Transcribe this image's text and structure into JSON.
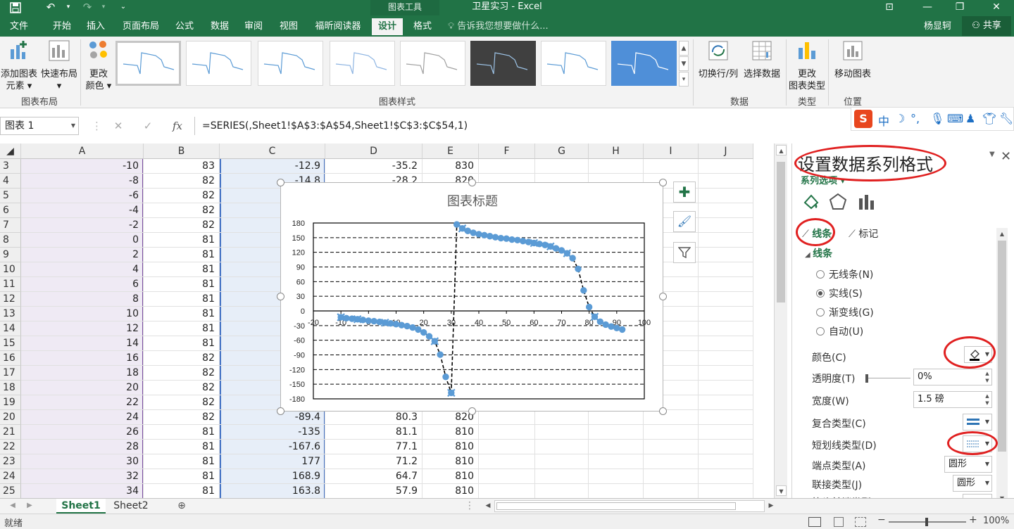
{
  "titlebar": {
    "context_tab": "图表工具",
    "window_title": "卫星实习 - Excel"
  },
  "tabs": {
    "file": "文件",
    "home": "开始",
    "insert": "插入",
    "page_layout": "页面布局",
    "formulas": "公式",
    "data": "数据",
    "review": "审阅",
    "view": "视图",
    "foxit": "福昕阅读器",
    "design": "设计",
    "format": "格式",
    "tell_me": "告诉我您想要做什么...",
    "user": "杨显轲",
    "share": "共享"
  },
  "ribbon": {
    "add_element_line1": "添加图表",
    "add_element_line2": "元素",
    "quick_layout": "快速布局",
    "change_colors_line1": "更改",
    "change_colors_line2": "颜色",
    "group_layout": "图表布局",
    "group_styles": "图表样式",
    "switch_row_col": "切换行/列",
    "select_data": "选择数据",
    "group_data": "数据",
    "change_type_line1": "更改",
    "change_type_line2": "图表类型",
    "group_type": "类型",
    "move_chart": "移动图表",
    "group_location": "位置"
  },
  "formula_bar": {
    "name_box": "图表 1",
    "fx": "fx",
    "formula": "=SERIES(,Sheet1!$A$3:$A$54,Sheet1!$C$3:$C$54,1)"
  },
  "columns": [
    "A",
    "B",
    "C",
    "D",
    "E",
    "F",
    "G",
    "H",
    "I",
    "J"
  ],
  "rows": [
    {
      "n": "3",
      "a": "-10",
      "b": "83",
      "c": "-12.9",
      "d": "-35.2",
      "e": "830"
    },
    {
      "n": "4",
      "a": "-8",
      "b": "82",
      "c": "-14.8",
      "d": "-28.2",
      "e": "820"
    },
    {
      "n": "5",
      "a": "-6",
      "b": "82",
      "c": "",
      "d": "",
      "e": ""
    },
    {
      "n": "6",
      "a": "-4",
      "b": "82",
      "c": "",
      "d": "",
      "e": ""
    },
    {
      "n": "7",
      "a": "-2",
      "b": "82",
      "c": "",
      "d": "",
      "e": ""
    },
    {
      "n": "8",
      "a": "0",
      "b": "81",
      "c": "",
      "d": "",
      "e": ""
    },
    {
      "n": "9",
      "a": "2",
      "b": "81",
      "c": "",
      "d": "",
      "e": ""
    },
    {
      "n": "10",
      "a": "4",
      "b": "81",
      "c": "",
      "d": "",
      "e": ""
    },
    {
      "n": "11",
      "a": "6",
      "b": "81",
      "c": "",
      "d": "",
      "e": ""
    },
    {
      "n": "12",
      "a": "8",
      "b": "81",
      "c": "",
      "d": "",
      "e": ""
    },
    {
      "n": "13",
      "a": "10",
      "b": "81",
      "c": "",
      "d": "",
      "e": ""
    },
    {
      "n": "14",
      "a": "12",
      "b": "81",
      "c": "",
      "d": "",
      "e": ""
    },
    {
      "n": "15",
      "a": "14",
      "b": "81",
      "c": "",
      "d": "",
      "e": ""
    },
    {
      "n": "16",
      "a": "16",
      "b": "82",
      "c": "",
      "d": "",
      "e": ""
    },
    {
      "n": "17",
      "a": "18",
      "b": "82",
      "c": "",
      "d": "",
      "e": ""
    },
    {
      "n": "18",
      "a": "20",
      "b": "82",
      "c": "",
      "d": "",
      "e": ""
    },
    {
      "n": "19",
      "a": "22",
      "b": "82",
      "c": "",
      "d": "",
      "e": ""
    },
    {
      "n": "20",
      "a": "24",
      "b": "82",
      "c": "-89.4",
      "d": "80.3",
      "e": "820"
    },
    {
      "n": "21",
      "a": "26",
      "b": "81",
      "c": "-135",
      "d": "81.1",
      "e": "810"
    },
    {
      "n": "22",
      "a": "28",
      "b": "81",
      "c": "-167.6",
      "d": "77.1",
      "e": "810"
    },
    {
      "n": "23",
      "a": "30",
      "b": "81",
      "c": "177",
      "d": "71.2",
      "e": "810"
    },
    {
      "n": "24",
      "a": "32",
      "b": "81",
      "c": "168.9",
      "d": "64.7",
      "e": "810"
    },
    {
      "n": "25",
      "a": "34",
      "b": "81",
      "c": "163.8",
      "d": "57.9",
      "e": "810"
    }
  ],
  "chart": {
    "title": "图表标题",
    "x_ticks": [
      "-20",
      "-10",
      "0",
      "10",
      "20",
      "30",
      "40",
      "50",
      "60",
      "70",
      "80",
      "90",
      "100"
    ],
    "y_ticks": [
      "180",
      "150",
      "120",
      "90",
      "60",
      "30",
      "0",
      "-30",
      "-60",
      "-90",
      "-120",
      "-150",
      "-180"
    ]
  },
  "chart_data": {
    "type": "scatter",
    "title": "图表标题",
    "xlim": [
      -20,
      100
    ],
    "ylim": [
      -180,
      180
    ],
    "grid": "horizontal-dashed",
    "x": [
      -10,
      -8,
      -6,
      -4,
      -2,
      0,
      2,
      4,
      6,
      8,
      10,
      12,
      14,
      16,
      18,
      20,
      22,
      24,
      26,
      28,
      30,
      32,
      34,
      36,
      38,
      40,
      42,
      44,
      46,
      48,
      50,
      52,
      54,
      56,
      58,
      60,
      62,
      64,
      66,
      68,
      70,
      72,
      74,
      76,
      78,
      80,
      82,
      84,
      86,
      88,
      90,
      92
    ],
    "values": [
      -12.9,
      -14.8,
      -16,
      -17,
      -18.5,
      -20,
      -21,
      -22.5,
      -24,
      -25.5,
      -27,
      -29,
      -31,
      -34,
      -38,
      -44,
      -52,
      -62,
      -89.4,
      -135,
      -167.6,
      177,
      168.9,
      163.8,
      160,
      157,
      155,
      153,
      151,
      149,
      148,
      146,
      145,
      143,
      141,
      139,
      137,
      135,
      132,
      128,
      124,
      118,
      108,
      86,
      42,
      8,
      -12,
      -22,
      -28,
      -32,
      -35,
      -38
    ]
  },
  "pane": {
    "title": "设置数据系列格式",
    "series_options": "系列选项",
    "tab_line": "线条",
    "tab_marker": "标记",
    "section_line": "线条",
    "no_line": "无线条(N)",
    "solid_line": "实线(S)",
    "gradient_line": "渐变线(G)",
    "auto": "自动(U)",
    "color": "颜色(C)",
    "transparency": "透明度(T)",
    "transparency_value": "0%",
    "width": "宽度(W)",
    "width_value": "1.5 磅",
    "compound_type": "复合类型(C)",
    "dash_type": "短划线类型(D)",
    "cap_type": "端点类型(A)",
    "cap_value": "圆形",
    "join_type": "联接类型(J)",
    "join_value": "圆形",
    "arrow_type": "箭头前端类型(B)"
  },
  "sheets": [
    "Sheet1",
    "Sheet2"
  ],
  "status": {
    "ready": "就绪",
    "zoom": "100%"
  },
  "colors": {
    "excel_green": "#217346",
    "series": "#5b9bd5",
    "annotation": "#e02020"
  }
}
